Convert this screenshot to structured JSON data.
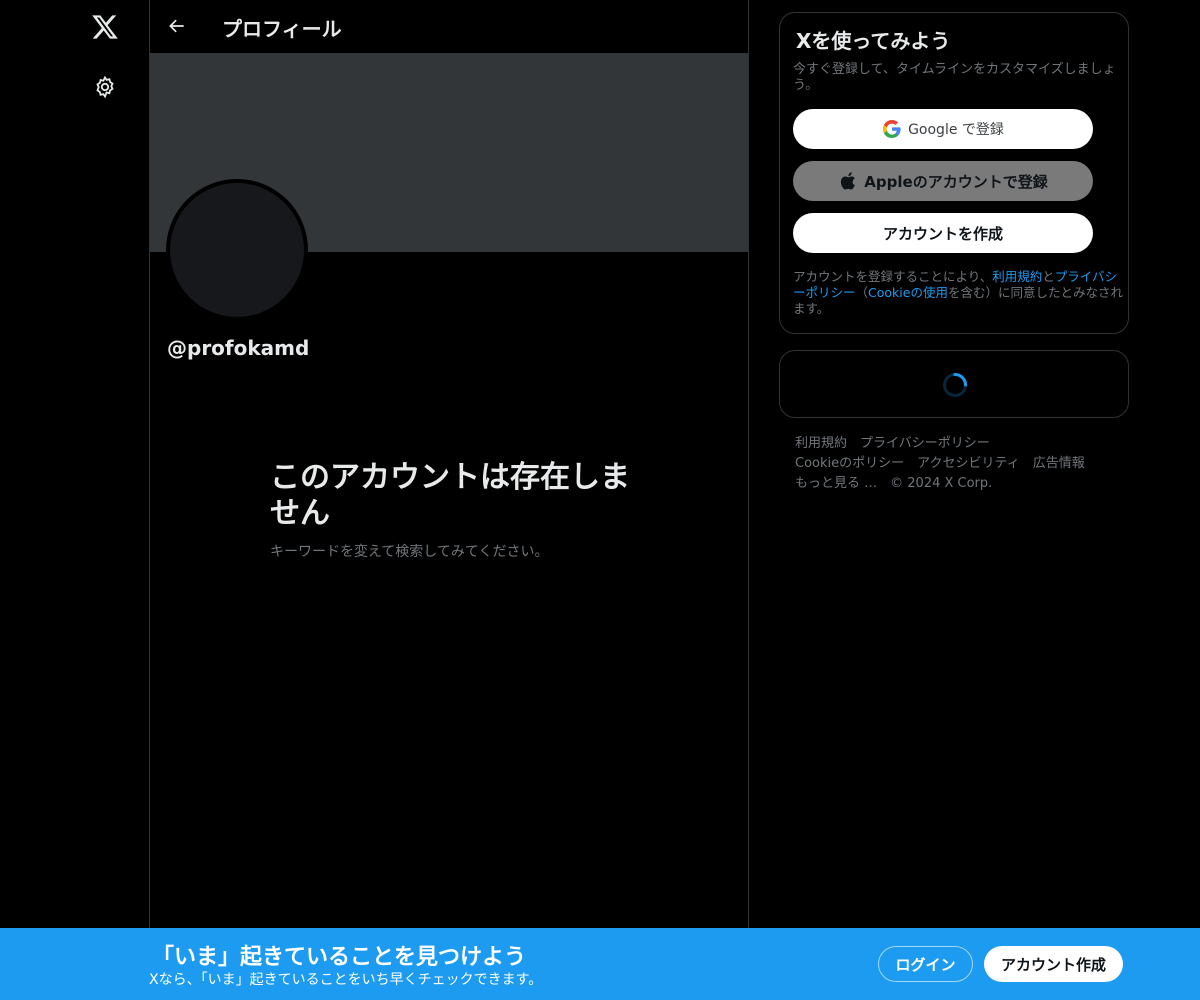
{
  "nav": {
    "logo_icon": "x-logo-icon",
    "settings_icon": "gear-icon"
  },
  "header": {
    "back_icon": "arrow-left-icon",
    "title": "プロフィール"
  },
  "profile": {
    "handle": "@profokamd"
  },
  "empty_state": {
    "title": "このアカウントは存在しません",
    "subtitle": "キーワードを変えて検索してみてください。"
  },
  "signup": {
    "title": "Xを使ってみよう",
    "subtitle": "今すぐ登録して、タイムラインをカスタマイズしましょう。",
    "google_label": "Google で登録",
    "apple_label": "Appleのアカウントで登録",
    "create_label": "アカウントを作成",
    "terms_prefix": "アカウントを登録することにより、",
    "terms_link": "利用規約",
    "terms_and": "と",
    "privacy_link": "プライバシーポリシー",
    "terms_mid": "（",
    "cookie_link": "Cookieの使用",
    "terms_suffix": "を含む）に同意したとみなされます。"
  },
  "footer": {
    "row1": [
      "利用規約",
      "プライバシーポリシー"
    ],
    "row2": [
      "Cookieのポリシー",
      "アクセシビリティ",
      "広告情報"
    ],
    "more": "もっと見る …",
    "copyright": "© 2024 X Corp."
  },
  "bottom_bar": {
    "title": "「いま」起きていることを見つけよう",
    "subtitle": "Xなら、「いま」起きていることをいち早くチェックできます。",
    "login_label": "ログイン",
    "create_label": "アカウント作成"
  },
  "colors": {
    "accent": "#1d9bf0",
    "background": "#000000",
    "banner": "#333639",
    "muted_text": "#71767b"
  }
}
